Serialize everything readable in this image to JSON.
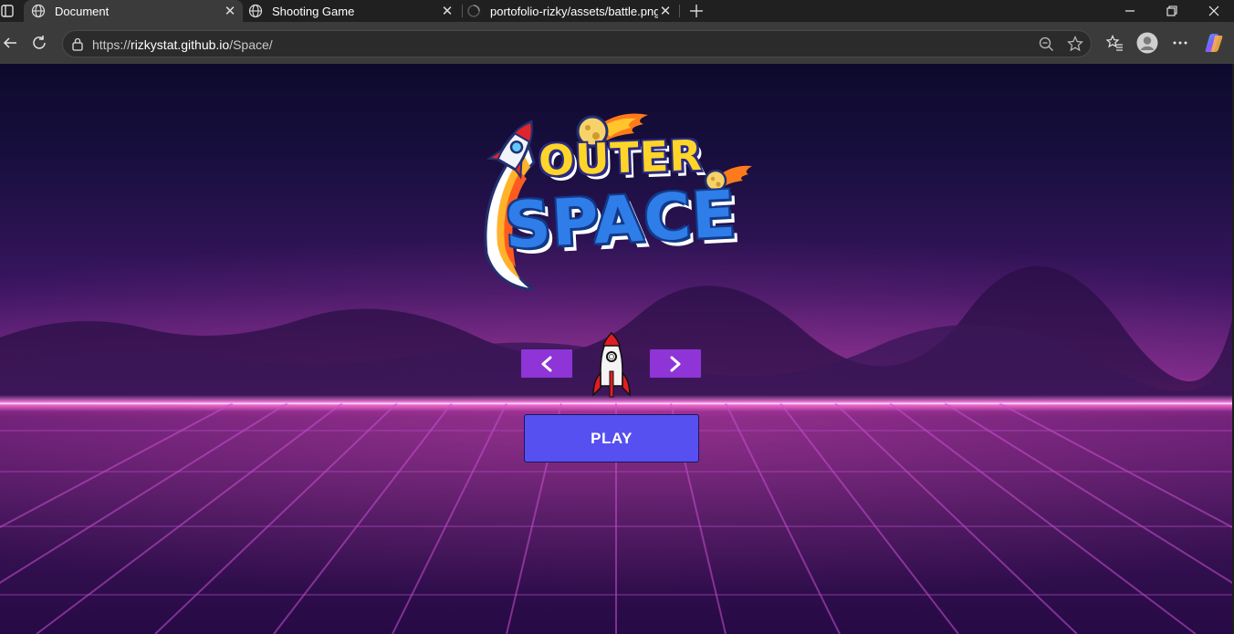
{
  "browser": {
    "tabs": [
      {
        "title": "Document",
        "active": true,
        "favicon": "globe-icon"
      },
      {
        "title": "Shooting Game",
        "active": false,
        "favicon": "globe-icon"
      },
      {
        "title": "portofolio-rizky/assets/battle.png",
        "active": false,
        "favicon": "loading-icon"
      }
    ],
    "url": {
      "protocol": "https://",
      "host": "rizkystat.github.io",
      "path": "/Space/"
    },
    "window_controls": [
      "minimize",
      "restore",
      "close"
    ],
    "toolbar_icons": [
      "back-icon",
      "refresh-icon",
      "site-info-icon",
      "zoom-out-icon",
      "favorite-star-icon",
      "favorites-icon",
      "profile-avatar-icon",
      "more-menu-icon",
      "copilot-icon"
    ]
  },
  "game": {
    "logo": {
      "line1": "OUTER",
      "line2": "SPACE"
    },
    "controls": {
      "prev_label": "‹",
      "next_label": "›",
      "play_label": "PLAY"
    },
    "colors": {
      "arrow_button": "#8f34d6",
      "play_button": "#5650f0",
      "horizon_glow": "#ff7ee0",
      "logo_yellow": "#ffd52a",
      "logo_blue": "#2f7de8"
    }
  }
}
